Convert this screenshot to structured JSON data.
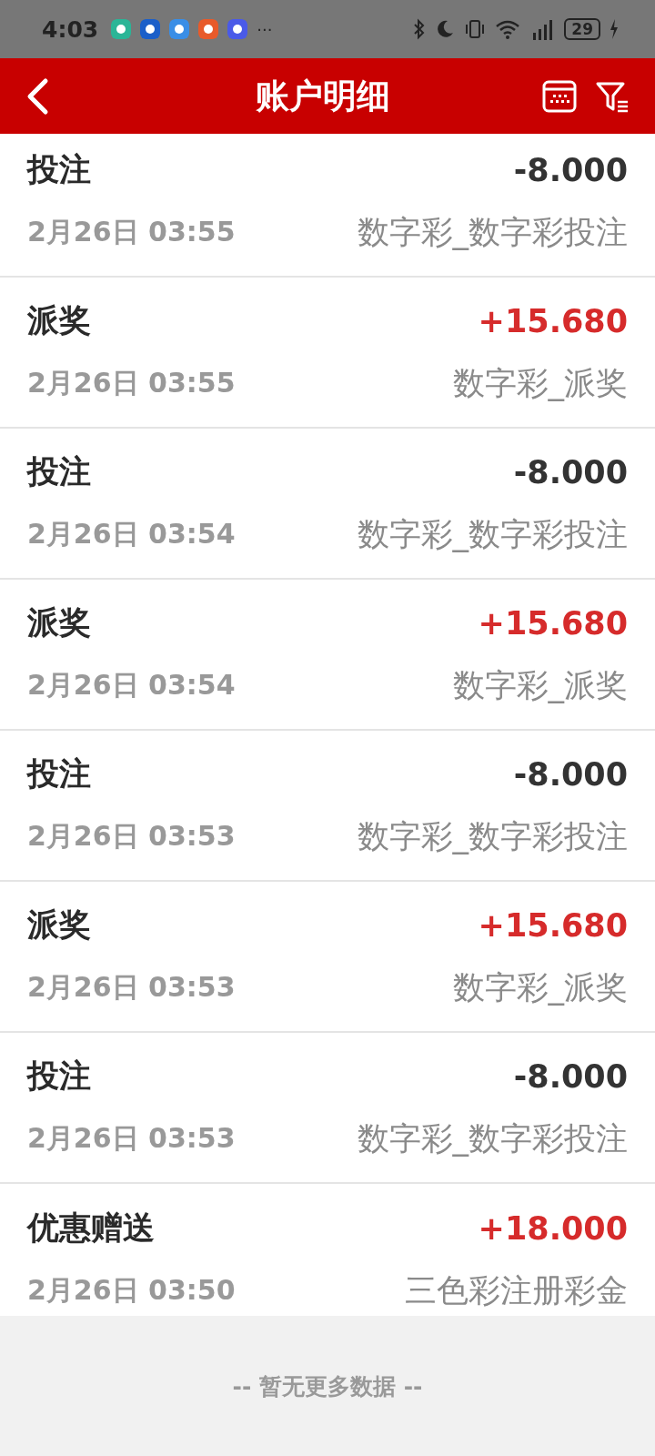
{
  "status_bar": {
    "time": "4:03",
    "more": "···",
    "battery": "29"
  },
  "header": {
    "title": "账户明细"
  },
  "records": [
    {
      "type": "投注",
      "amount": "-8.000",
      "kind": "expense",
      "time": "2月26日 03:55",
      "detail": "数字彩_数字彩投注"
    },
    {
      "type": "派奖",
      "amount": "+15.680",
      "kind": "income",
      "time": "2月26日 03:55",
      "detail": "数字彩_派奖"
    },
    {
      "type": "投注",
      "amount": "-8.000",
      "kind": "expense",
      "time": "2月26日 03:54",
      "detail": "数字彩_数字彩投注"
    },
    {
      "type": "派奖",
      "amount": "+15.680",
      "kind": "income",
      "time": "2月26日 03:54",
      "detail": "数字彩_派奖"
    },
    {
      "type": "投注",
      "amount": "-8.000",
      "kind": "expense",
      "time": "2月26日 03:53",
      "detail": "数字彩_数字彩投注"
    },
    {
      "type": "派奖",
      "amount": "+15.680",
      "kind": "income",
      "time": "2月26日 03:53",
      "detail": "数字彩_派奖"
    },
    {
      "type": "投注",
      "amount": "-8.000",
      "kind": "expense",
      "time": "2月26日 03:53",
      "detail": "数字彩_数字彩投注"
    },
    {
      "type": "优惠赠送",
      "amount": "+18.000",
      "kind": "income",
      "time": "2月26日 03:50",
      "detail": "三色彩注册彩金"
    }
  ],
  "footer": "-- 暂无更多数据 --"
}
